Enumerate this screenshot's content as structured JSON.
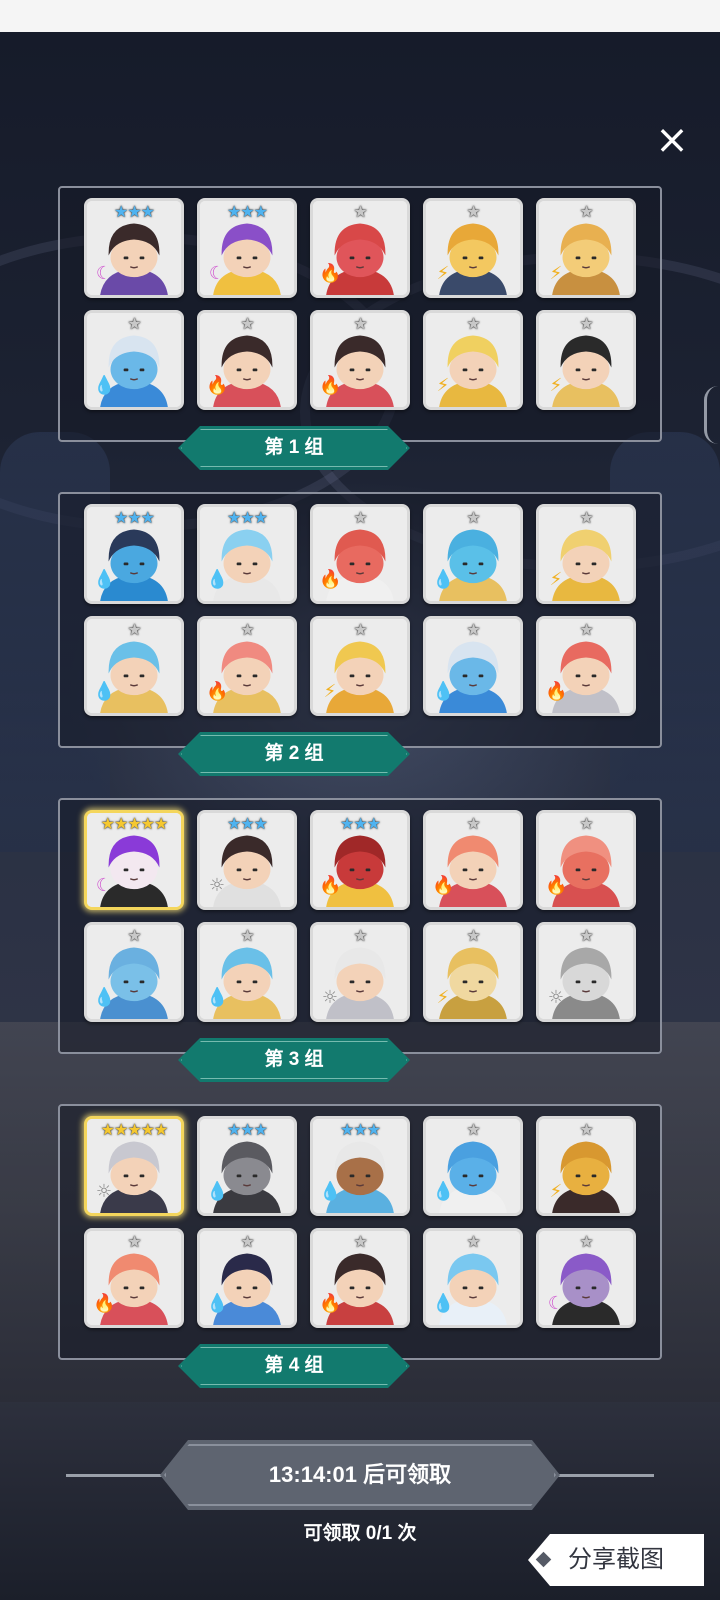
{
  "close_label": "×",
  "groups": [
    {
      "label": "第 1 组",
      "heroes": [
        {
          "stars": "★★★",
          "star_color": "#4fb3f0",
          "element_icon": "☾",
          "element": "moon-icon",
          "element_color": "#d05ad0",
          "skin": "#f3d2b8",
          "hair": "#3a2a2a",
          "accent": "#6a4aa8",
          "legend": false
        },
        {
          "stars": "★★★",
          "star_color": "#4fb3f0",
          "element_icon": "☾",
          "element": "moon-icon",
          "element_color": "#d05ad0",
          "skin": "#f3d2b8",
          "hair": "#8a4fc8",
          "accent": "#f0c040",
          "legend": false
        },
        {
          "stars": "★",
          "star_color": "#c8c8c8",
          "element_icon": "🔥",
          "element": "fire-icon",
          "element_color": "#e0452c",
          "skin": "#e0555a",
          "hair": "#d84848",
          "accent": "#c83a3a",
          "legend": false
        },
        {
          "stars": "★",
          "star_color": "#c8c8c8",
          "element_icon": "⚡",
          "element": "thunder-icon",
          "element_color": "#f0b020",
          "skin": "#f3c860",
          "hair": "#e8a838",
          "accent": "#3a4a6a",
          "legend": false
        },
        {
          "stars": "★",
          "star_color": "#c8c8c8",
          "element_icon": "⚡",
          "element": "thunder-icon",
          "element_color": "#f0b020",
          "skin": "#f3cc78",
          "hair": "#e8b050",
          "accent": "#c89040",
          "legend": false
        },
        {
          "stars": "★",
          "star_color": "#c8c8c8",
          "element_icon": "💧",
          "element": "water-icon",
          "element_color": "#2a7ad8",
          "skin": "#6ab8e8",
          "hair": "#d8e4f0",
          "accent": "#3a8ad8",
          "legend": false
        },
        {
          "stars": "★",
          "star_color": "#c8c8c8",
          "element_icon": "🔥",
          "element": "fire-icon",
          "element_color": "#e0452c",
          "skin": "#f3d2b8",
          "hair": "#3a2a2a",
          "accent": "#d8505a",
          "legend": false
        },
        {
          "stars": "★",
          "star_color": "#c8c8c8",
          "element_icon": "🔥",
          "element": "fire-icon",
          "element_color": "#e0452c",
          "skin": "#f3d2b8",
          "hair": "#3a2a2a",
          "accent": "#d8505a",
          "legend": false
        },
        {
          "stars": "★",
          "star_color": "#c8c8c8",
          "element_icon": "⚡",
          "element": "thunder-icon",
          "element_color": "#f0b020",
          "skin": "#f3d2b8",
          "hair": "#f0d060",
          "accent": "#e8b840",
          "legend": false
        },
        {
          "stars": "★",
          "star_color": "#c8c8c8",
          "element_icon": "⚡",
          "element": "thunder-icon",
          "element_color": "#f0b020",
          "skin": "#f3d2b8",
          "hair": "#2a2a2a",
          "accent": "#e8c060",
          "legend": false
        }
      ]
    },
    {
      "label": "第 2 组",
      "heroes": [
        {
          "stars": "★★★",
          "star_color": "#4fb3f0",
          "element_icon": "💧",
          "element": "water-icon",
          "element_color": "#2a7ad8",
          "skin": "#4aa8e0",
          "hair": "#2a3a5a",
          "accent": "#2a8ad0",
          "legend": false
        },
        {
          "stars": "★★★",
          "star_color": "#4fb3f0",
          "element_icon": "💧",
          "element": "water-icon",
          "element_color": "#2a7ad8",
          "skin": "#f3d2b8",
          "hair": "#8ad0f0",
          "accent": "#e8e8e8",
          "legend": false
        },
        {
          "stars": "★",
          "star_color": "#c8c8c8",
          "element_icon": "🔥",
          "element": "fire-icon",
          "element_color": "#e0452c",
          "skin": "#e86a60",
          "hair": "#e05a50",
          "accent": "#f0f0f0",
          "legend": false
        },
        {
          "stars": "★",
          "star_color": "#c8c8c8",
          "element_icon": "💧",
          "element": "water-icon",
          "element_color": "#2a7ad8",
          "skin": "#5ac0e8",
          "hair": "#4ab0e0",
          "accent": "#e8c060",
          "legend": false
        },
        {
          "stars": "★",
          "star_color": "#c8c8c8",
          "element_icon": "⚡",
          "element": "thunder-icon",
          "element_color": "#f0b020",
          "skin": "#f3d2b8",
          "hair": "#f0d070",
          "accent": "#e8b840",
          "legend": false
        },
        {
          "stars": "★",
          "star_color": "#c8c8c8",
          "element_icon": "💧",
          "element": "water-icon",
          "element_color": "#2a7ad8",
          "skin": "#f3d2b8",
          "hair": "#6ac0e8",
          "accent": "#e8c060",
          "legend": false
        },
        {
          "stars": "★",
          "star_color": "#c8c8c8",
          "element_icon": "🔥",
          "element": "fire-icon",
          "element_color": "#e0452c",
          "skin": "#f3d2b8",
          "hair": "#f08a80",
          "accent": "#e8c060",
          "legend": false
        },
        {
          "stars": "★",
          "star_color": "#c8c8c8",
          "element_icon": "⚡",
          "element": "thunder-icon",
          "element_color": "#f0b020",
          "skin": "#f3d2b8",
          "hair": "#f0c850",
          "accent": "#e8a838",
          "legend": false
        },
        {
          "stars": "★",
          "star_color": "#c8c8c8",
          "element_icon": "💧",
          "element": "water-icon",
          "element_color": "#2a7ad8",
          "skin": "#6ab8e8",
          "hair": "#d8e4f0",
          "accent": "#3a8ad8",
          "legend": false
        },
        {
          "stars": "★",
          "star_color": "#c8c8c8",
          "element_icon": "🔥",
          "element": "fire-icon",
          "element_color": "#e0452c",
          "skin": "#f3d2b8",
          "hair": "#e86a60",
          "accent": "#c0c0c8",
          "legend": false
        }
      ]
    },
    {
      "label": "第 3 组",
      "heroes": [
        {
          "stars": "★★★★★",
          "star_color": "#f5c830",
          "element_icon": "☾",
          "element": "moon-icon",
          "element_color": "#d05ad0",
          "skin": "#f3e8f0",
          "hair": "#8a3ad8",
          "accent": "#2a2a2a",
          "legend": true
        },
        {
          "stars": "★★★",
          "star_color": "#4fb3f0",
          "element_icon": "☼",
          "element": "light-icon",
          "element_color": "#8a8a8a",
          "skin": "#f3d2b8",
          "hair": "#3a2a2a",
          "accent": "#e0e0e0",
          "legend": false
        },
        {
          "stars": "★★★",
          "star_color": "#4fb3f0",
          "element_icon": "🔥",
          "element": "fire-icon",
          "element_color": "#e0452c",
          "skin": "#c83a3a",
          "hair": "#a02828",
          "accent": "#f0c040",
          "legend": false
        },
        {
          "stars": "★",
          "star_color": "#c8c8c8",
          "element_icon": "🔥",
          "element": "fire-icon",
          "element_color": "#e0452c",
          "skin": "#f3d2b8",
          "hair": "#f08a70",
          "accent": "#d8505a",
          "legend": false
        },
        {
          "stars": "★",
          "star_color": "#c8c8c8",
          "element_icon": "🔥",
          "element": "fire-icon",
          "element_color": "#e0452c",
          "skin": "#e87060",
          "hair": "#f09080",
          "accent": "#d85050",
          "legend": false
        },
        {
          "stars": "★",
          "star_color": "#c8c8c8",
          "element_icon": "💧",
          "element": "water-icon",
          "element_color": "#2a7ad8",
          "skin": "#7ac0e8",
          "hair": "#6ab0e0",
          "accent": "#4a90d0",
          "legend": false
        },
        {
          "stars": "★",
          "star_color": "#c8c8c8",
          "element_icon": "💧",
          "element": "water-icon",
          "element_color": "#2a7ad8",
          "skin": "#f3d2b8",
          "hair": "#6ac0e8",
          "accent": "#e8c060",
          "legend": false
        },
        {
          "stars": "★",
          "star_color": "#c8c8c8",
          "element_icon": "☼",
          "element": "light-icon",
          "element_color": "#8a8a8a",
          "skin": "#f3d2b8",
          "hair": "#e8e8e8",
          "accent": "#c0c0c8",
          "legend": false
        },
        {
          "stars": "★",
          "star_color": "#c8c8c8",
          "element_icon": "⚡",
          "element": "thunder-icon",
          "element_color": "#f0b020",
          "skin": "#f0d8a0",
          "hair": "#e8c060",
          "accent": "#c8a040",
          "legend": false
        },
        {
          "stars": "★",
          "star_color": "#c8c8c8",
          "element_icon": "☼",
          "element": "light-icon",
          "element_color": "#8a8a8a",
          "skin": "#d8d8d8",
          "hair": "#a8a8a8",
          "accent": "#8a8a8a",
          "legend": false
        }
      ]
    },
    {
      "label": "第 4 组",
      "heroes": [
        {
          "stars": "★★★★★",
          "star_color": "#f5c830",
          "element_icon": "☼",
          "element": "light-icon",
          "element_color": "#8a8a8a",
          "skin": "#f3d2b8",
          "hair": "#c8c8d0",
          "accent": "#3a3a4a",
          "legend": true
        },
        {
          "stars": "★★★",
          "star_color": "#4fb3f0",
          "element_icon": "💧",
          "element": "water-icon",
          "element_color": "#2a7ad8",
          "skin": "#8a8a90",
          "hair": "#5a5a60",
          "accent": "#3a3a40",
          "legend": false
        },
        {
          "stars": "★★★",
          "star_color": "#4fb3f0",
          "element_icon": "💧",
          "element": "water-icon",
          "element_color": "#2a7ad8",
          "skin": "#a87048",
          "hair": "#e8e8e8",
          "accent": "#5ab0e0",
          "legend": false
        },
        {
          "stars": "★",
          "star_color": "#c8c8c8",
          "element_icon": "💧",
          "element": "water-icon",
          "element_color": "#2a7ad8",
          "skin": "#5ab0e8",
          "hair": "#4aa0e0",
          "accent": "#f0f0f0",
          "legend": false
        },
        {
          "stars": "★",
          "star_color": "#c8c8c8",
          "element_icon": "⚡",
          "element": "thunder-icon",
          "element_color": "#f0b020",
          "skin": "#e8b040",
          "hair": "#d89830",
          "accent": "#3a2a2a",
          "legend": false
        },
        {
          "stars": "★",
          "star_color": "#c8c8c8",
          "element_icon": "🔥",
          "element": "fire-icon",
          "element_color": "#e0452c",
          "skin": "#f3d2b8",
          "hair": "#f08a70",
          "accent": "#d8505a",
          "legend": false
        },
        {
          "stars": "★",
          "star_color": "#c8c8c8",
          "element_icon": "💧",
          "element": "water-icon",
          "element_color": "#2a7ad8",
          "skin": "#f3d2b8",
          "hair": "#2a2a4a",
          "accent": "#4a8ad8",
          "legend": false
        },
        {
          "stars": "★",
          "star_color": "#c8c8c8",
          "element_icon": "🔥",
          "element": "fire-icon",
          "element_color": "#e0452c",
          "skin": "#f3d2b8",
          "hair": "#3a2a2a",
          "accent": "#c84040",
          "legend": false
        },
        {
          "stars": "★",
          "star_color": "#c8c8c8",
          "element_icon": "💧",
          "element": "water-icon",
          "element_color": "#2a7ad8",
          "skin": "#f3d2b8",
          "hair": "#7ac8f0",
          "accent": "#e8f0f8",
          "legend": false
        },
        {
          "stars": "★",
          "star_color": "#c8c8c8",
          "element_icon": "☾",
          "element": "moon-icon",
          "element_color": "#d05ad0",
          "skin": "#a890c8",
          "hair": "#8a5ac8",
          "accent": "#2a2a2a",
          "legend": false
        }
      ]
    }
  ],
  "timer_text": "13:14:01 后可领取",
  "claim_text": "可领取 0/1 次",
  "share_label": "分享截图"
}
